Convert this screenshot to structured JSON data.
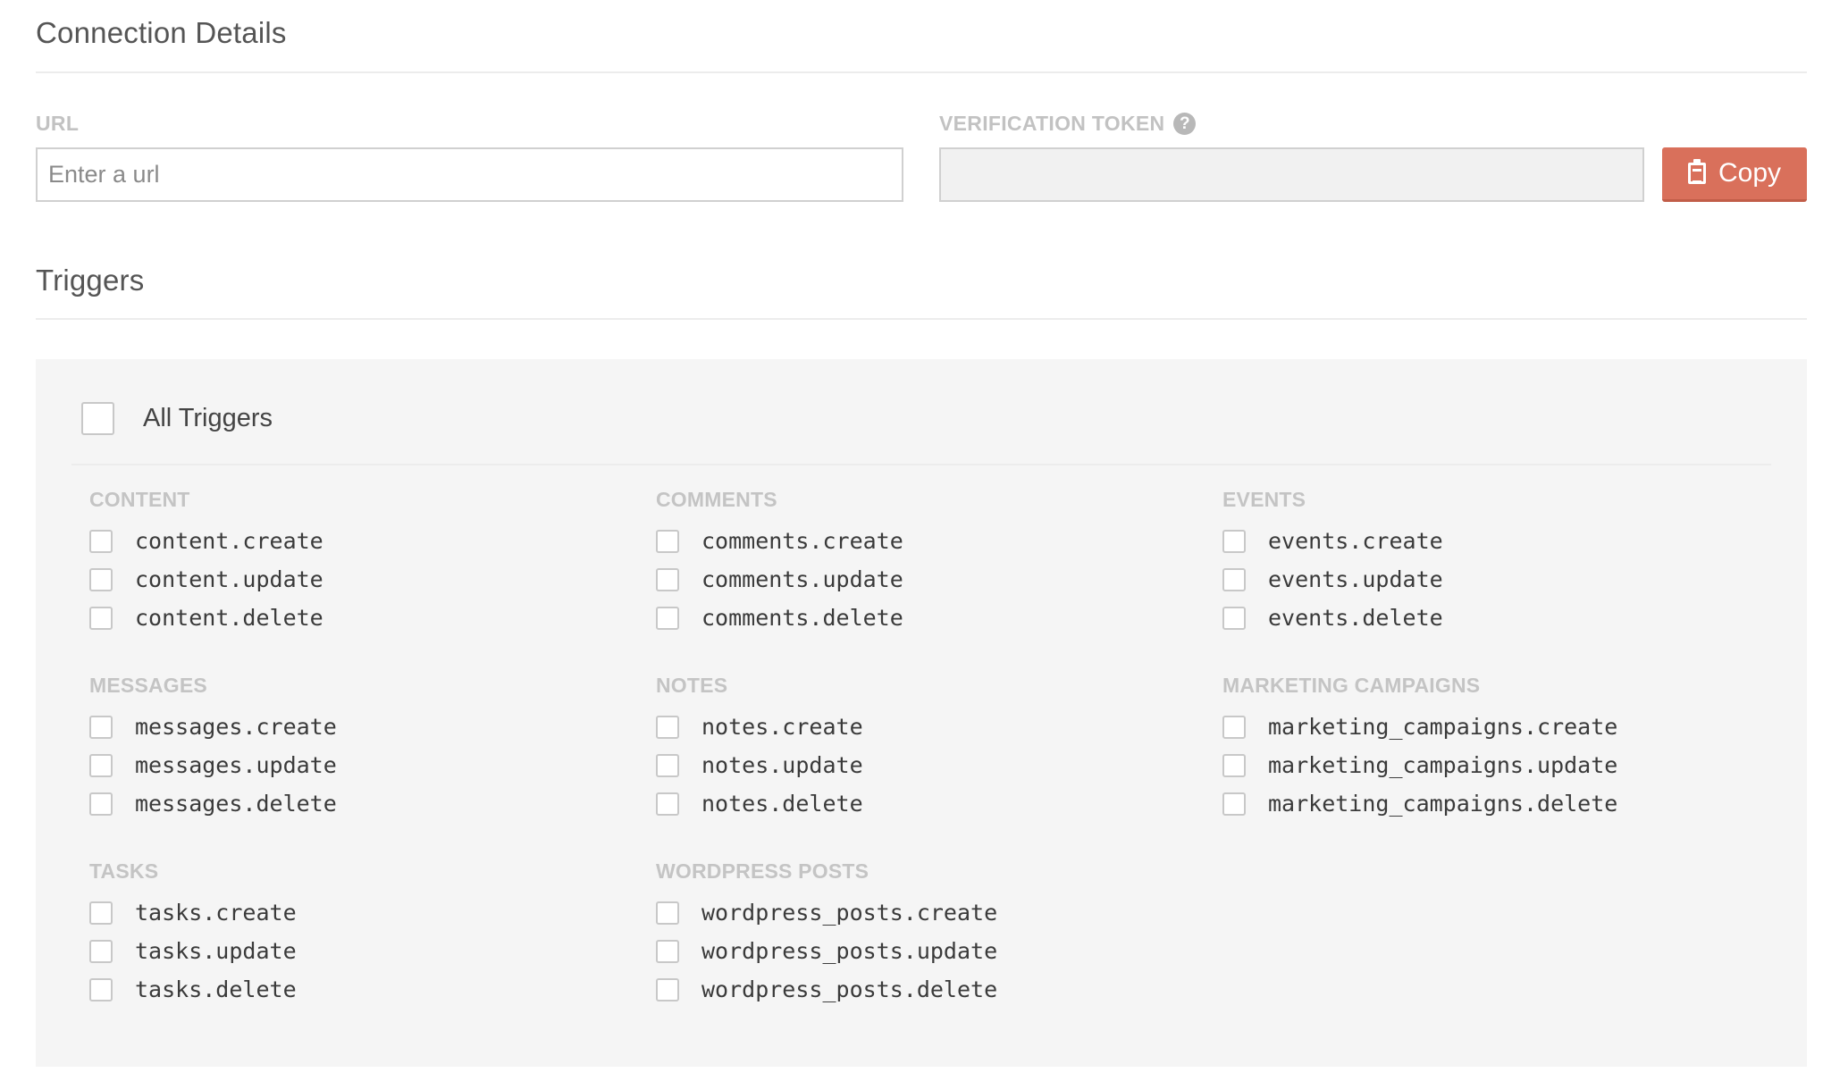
{
  "connection": {
    "title": "Connection Details",
    "url_label": "URL",
    "url_placeholder": "Enter a url",
    "url_value": "",
    "token_label": "VERIFICATION TOKEN",
    "token_value": "",
    "copy_label": "Copy"
  },
  "triggers": {
    "title": "Triggers",
    "all_label": "All Triggers",
    "groups": [
      {
        "title": "CONTENT",
        "items": [
          "content.create",
          "content.update",
          "content.delete"
        ]
      },
      {
        "title": "COMMENTS",
        "items": [
          "comments.create",
          "comments.update",
          "comments.delete"
        ]
      },
      {
        "title": "EVENTS",
        "items": [
          "events.create",
          "events.update",
          "events.delete"
        ]
      },
      {
        "title": "MESSAGES",
        "items": [
          "messages.create",
          "messages.update",
          "messages.delete"
        ]
      },
      {
        "title": "NOTES",
        "items": [
          "notes.create",
          "notes.update",
          "notes.delete"
        ]
      },
      {
        "title": "MARKETING CAMPAIGNS",
        "items": [
          "marketing_campaigns.create",
          "marketing_campaigns.update",
          "marketing_campaigns.delete"
        ]
      },
      {
        "title": "TASKS",
        "items": [
          "tasks.create",
          "tasks.update",
          "tasks.delete"
        ]
      },
      {
        "title": "WORDPRESS POSTS",
        "items": [
          "wordpress_posts.create",
          "wordpress_posts.update",
          "wordpress_posts.delete"
        ]
      }
    ]
  },
  "colors": {
    "accent": "#d9705b",
    "panel_bg": "#f5f5f5",
    "label_gray": "#c4c4c4"
  }
}
